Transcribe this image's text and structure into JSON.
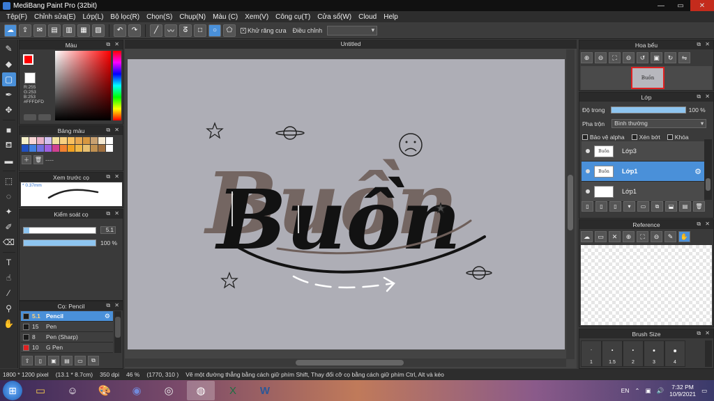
{
  "window": {
    "title": "MediBang Paint Pro (32bit)",
    "controls": [
      "—",
      "▭",
      "✕"
    ]
  },
  "menu": [
    "Tệp(F)",
    "Chỉnh sửa(E)",
    "Lớp(L)",
    "Bộ lọc(R)",
    "Chọn(S)",
    "Chụp(N)",
    "Màu (C)",
    "Xem(V)",
    "Công cụ(T)",
    "Cửa sổ(W)",
    "Cloud",
    "Help"
  ],
  "toolbar": {
    "antialias_label": "Khử răng cưa",
    "adjust_label": "Điều chỉnh",
    "adjust_value": ""
  },
  "color_panel": {
    "title": "Màu",
    "fg_color": "#FF0000",
    "bg_color": "#3A6FE0",
    "rgb_r": "R:255",
    "rgb_g": "G:253",
    "rgb_b": "B:253",
    "hex": "#FFFDFD"
  },
  "palette_panel": {
    "title": "Bảng màu",
    "colors": [
      "#f6f0c8",
      "#f7d6d6",
      "#e8b0c8",
      "#d0c0f0",
      "#f0e0a0",
      "#f8d080",
      "#f8c060",
      "#e8a850",
      "#d89840",
      "#c8a070",
      "#f4e8d0",
      "#ffffff",
      "#2050c0",
      "#4080e0",
      "#7070e0",
      "#a060e0",
      "#d04090",
      "#f08030",
      "#f0a020",
      "#f0b848",
      "#e8c070",
      "#c09050",
      "#a07040",
      "#ffffff"
    ],
    "dashes": "----"
  },
  "brush_preview": {
    "title": "Xem trước cọ",
    "size": "* 0.37mm"
  },
  "brush_control": {
    "title": "Kiểm soát cọ",
    "size_value": "5.1",
    "size_fraction": 0.08,
    "opacity_label": "100 %",
    "opacity_fraction": 1.0
  },
  "brush_panel": {
    "title": "Cọ: Pencil",
    "items": [
      {
        "size": "5.1",
        "name": "Pencil",
        "color": "#1a1a1a",
        "selected": true
      },
      {
        "size": "15",
        "name": "Pen",
        "color": "#1a1a1a",
        "selected": false
      },
      {
        "size": "8",
        "name": "Pen (Sharp)",
        "color": "#1a1a1a",
        "selected": false
      },
      {
        "size": "10",
        "name": "G Pen",
        "color": "#e02020",
        "selected": false
      }
    ]
  },
  "document": {
    "tab_title": "Untitled",
    "artwork_text": "Buồn"
  },
  "navigator": {
    "title": "Hoa bểu",
    "thumb_text": "Buồn"
  },
  "layer_panel": {
    "title": "Lớp",
    "opacity_label": "Độ trong",
    "opacity_value": "100 %",
    "blend_label": "Pha trộn",
    "blend_value": "Bình thường",
    "protect_alpha": "Bảo vệ alpha",
    "clipping": "Xén bớt",
    "lock": "Khóa",
    "layers": [
      {
        "name": "Lớp3",
        "thumb": "Buồn",
        "selected": false
      },
      {
        "name": "Lớp1",
        "thumb": "Buồn",
        "selected": true
      },
      {
        "name": "Lớp1",
        "thumb": "",
        "selected": false
      }
    ]
  },
  "reference_panel": {
    "title": "Reference"
  },
  "brush_size_panel": {
    "title": "Brush Size",
    "sizes": [
      "1",
      "1.5",
      "2",
      "3",
      "4"
    ]
  },
  "status": {
    "dimensions": "1800 * 1200 pixel",
    "physical": "(13.1 * 8.7cm)",
    "dpi": "350 dpi",
    "zoom": "46 %",
    "coords": "(1770, 310 )",
    "hint": "Vẽ một đường thẳng bằng cách giữ phím Shift, Thay đổi cỡ cọ bằng cách giữ phím Ctrl, Alt và kéo"
  },
  "taskbar": {
    "lang": "EN",
    "time": "7:32 PM",
    "date": "10/9/2021"
  }
}
